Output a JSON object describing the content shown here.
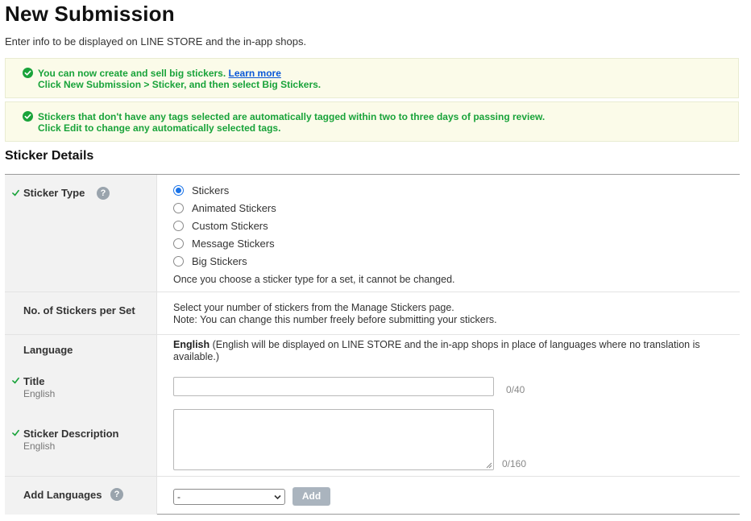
{
  "page": {
    "title": "New Submission",
    "subtitle": "Enter info to be displayed on LINE STORE and the in-app shops."
  },
  "notices": [
    {
      "line1": "You can now create and sell big stickers.",
      "link": "Learn more",
      "line2": "Click New Submission > Sticker, and then select Big Stickers."
    },
    {
      "line1": "Stickers that don't have any tags selected are automatically tagged within two to three days of passing review.",
      "line2": "Click Edit to change any automatically selected tags."
    }
  ],
  "section_title": "Sticker Details",
  "sticker_type": {
    "label": "Sticker Type",
    "help": "?",
    "options": [
      "Stickers",
      "Animated Stickers",
      "Custom Stickers",
      "Message Stickers",
      "Big Stickers"
    ],
    "selected": "Stickers",
    "note": "Once you choose a sticker type for a set, it cannot be changed."
  },
  "stickers_per_set": {
    "label": "No. of Stickers per Set",
    "line1": "Select your number of stickers from the Manage Stickers page.",
    "line2": "Note: You can change this number freely before submitting your stickers."
  },
  "language": {
    "label": "Language",
    "value_bold": "English",
    "value_rest": " (English will be displayed on LINE STORE and the in-app shops in place of languages where no translation is available.)"
  },
  "title_field": {
    "label": "Title",
    "sublabel": "English",
    "value": "",
    "counter": "0/40"
  },
  "description_field": {
    "label": "Sticker Description",
    "sublabel": "English",
    "value": "",
    "counter": "0/160"
  },
  "add_languages": {
    "label": "Add Languages",
    "help": "?",
    "selected": "-",
    "button": "Add"
  },
  "colors": {
    "success_green": "#19a33a",
    "link_blue": "#0a58d8",
    "radio_blue": "#1a73e8",
    "notice_bg": "#fbfbe9",
    "label_bg": "#f2f2f2",
    "disabled_button": "#aab4be"
  },
  "icons": {
    "notice": "check-circle-icon",
    "validated": "checkmark-icon",
    "help": "question-circle-icon",
    "select": "chevron-down-icon"
  }
}
